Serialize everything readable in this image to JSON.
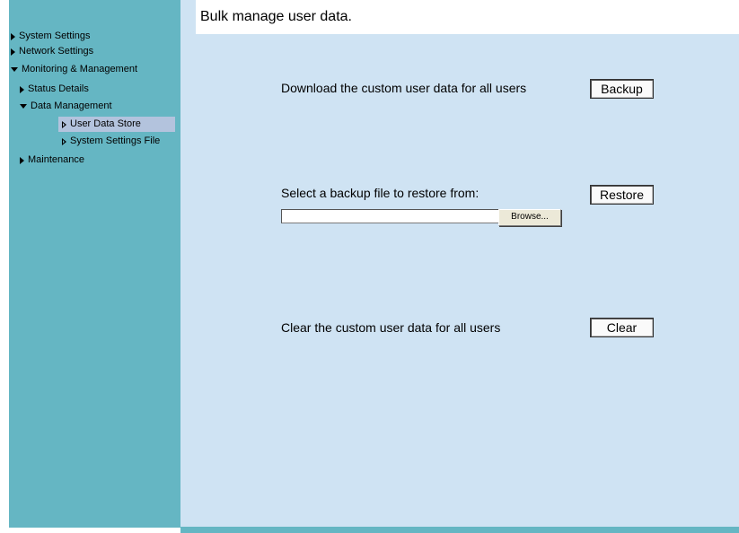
{
  "sidebar": {
    "items": [
      {
        "label": "System Settings",
        "expanded": false,
        "level": 0
      },
      {
        "label": "Network Settings",
        "expanded": false,
        "level": 0
      },
      {
        "label": "Monitoring & Management",
        "expanded": true,
        "level": 0
      },
      {
        "label": "Status Details",
        "expanded": false,
        "level": 1
      },
      {
        "label": "Data Management",
        "expanded": true,
        "level": 1
      },
      {
        "label": "User Data Store",
        "expanded": false,
        "level": 2,
        "selected": true
      },
      {
        "label": "System Settings File",
        "expanded": false,
        "level": 2
      },
      {
        "label": "Maintenance",
        "expanded": false,
        "level": 1
      }
    ]
  },
  "main": {
    "title": "Bulk manage user data.",
    "backup": {
      "text": "Download the custom user data for all users",
      "button_label": "Backup"
    },
    "restore": {
      "text": "Select a backup file to restore from:",
      "button_label": "Restore",
      "file_value": "",
      "browse_label": "Browse..."
    },
    "clear": {
      "text": "Clear the custom user data for all users",
      "button_label": "Clear"
    }
  },
  "colors": {
    "sidebar_bg": "#65b6c3",
    "main_bg": "#cfe3f3",
    "selected_bg": "#b3c3dd"
  }
}
